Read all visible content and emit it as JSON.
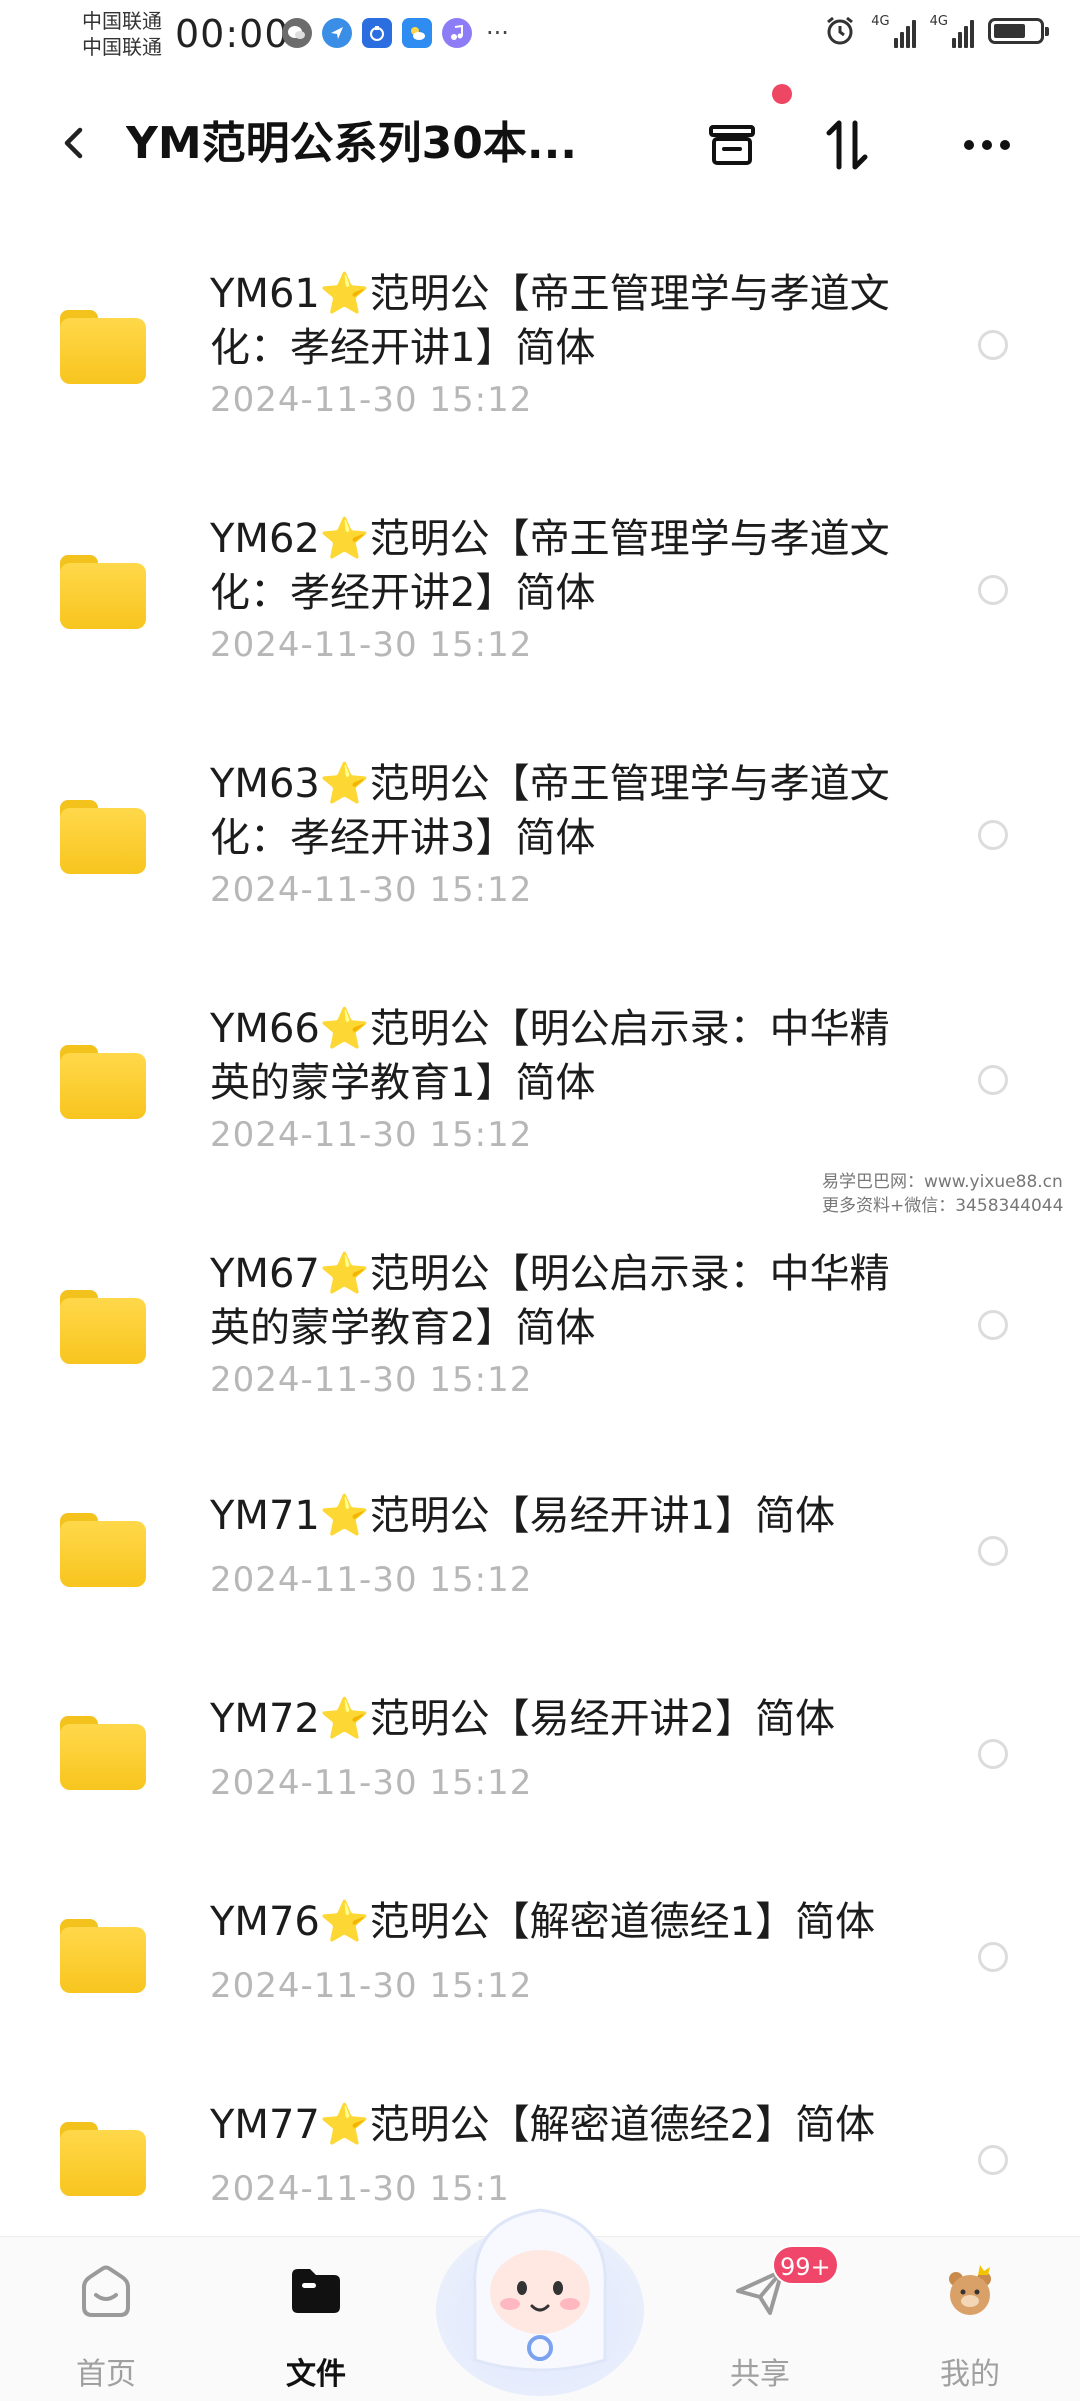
{
  "status_bar": {
    "carrier_1": "中国联通",
    "carrier_2": "中国联通",
    "time": "00:00",
    "app_icons": [
      "wechat-icon",
      "browser-icon",
      "weibo-icon",
      "weather-icon",
      "music-icon"
    ],
    "more": "···",
    "signal_label_1": "4G",
    "signal_label_2": "4G",
    "battery_level": 0.7
  },
  "header": {
    "title": "YM范明公系列30本...",
    "icons": [
      "back-icon",
      "archive-icon",
      "sort-icon",
      "more-icon"
    ],
    "has_notification_dot": true
  },
  "files": [
    {
      "title": "YM61⭐范明公【帝王管理学与孝道文化：孝经开讲1】简体",
      "date": "2024-11-30  15:12"
    },
    {
      "title": "YM62⭐范明公【帝王管理学与孝道文化：孝经开讲2】简体",
      "date": "2024-11-30  15:12"
    },
    {
      "title": "YM63⭐范明公【帝王管理学与孝道文化：孝经开讲3】简体",
      "date": "2024-11-30  15:12"
    },
    {
      "title": "YM66⭐范明公【明公启示录：中华精英的蒙学教育1】简体",
      "date": "2024-11-30  15:12"
    },
    {
      "title": "YM67⭐范明公【明公启示录：中华精英的蒙学教育2】简体",
      "date": "2024-11-30  15:12"
    },
    {
      "title": "YM71⭐范明公【易经开讲1】简体",
      "date": "2024-11-30  15:12"
    },
    {
      "title": "YM72⭐范明公【易经开讲2】简体",
      "date": "2024-11-30  15:12"
    },
    {
      "title": "YM76⭐范明公【解密道德经1】简体",
      "date": "2024-11-30  15:12"
    },
    {
      "title": "YM77⭐范明公【解密道德经2】简体",
      "date": "2024-11-30  15:1"
    }
  ],
  "watermark": {
    "line1": "易学巴巴网：www.yixue88.cn",
    "line2": "更多资料+微信：3458344044"
  },
  "bottom_nav": {
    "items": [
      {
        "label": "首页",
        "icon": "home-icon",
        "active": false
      },
      {
        "label": "文件",
        "icon": "files-icon",
        "active": true
      },
      {
        "label": "共享",
        "icon": "share-icon",
        "active": false,
        "badge": "99+"
      },
      {
        "label": "我的",
        "icon": "profile-icon",
        "active": false
      }
    ],
    "mascot": "cloud-mascot-icon"
  },
  "colors": {
    "folder": "#f8c51e",
    "badge": "#f0466a",
    "date_text": "#b7b7b7",
    "inactive_nav": "#a0a0a0"
  }
}
